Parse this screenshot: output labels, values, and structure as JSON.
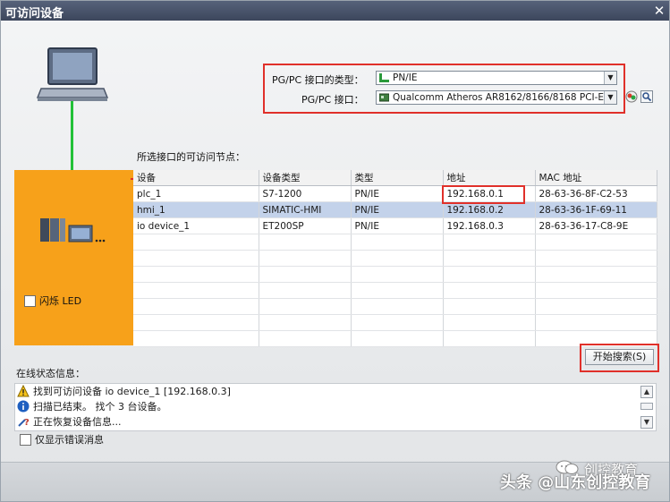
{
  "window": {
    "title": "可访问设备",
    "close_glyph": "✕"
  },
  "interface_form": {
    "type_label": "PG/PC 接口的类型：",
    "type_value": "PN/IE",
    "interface_label": "PG/PC 接口：",
    "interface_value": "Qualcomm Atheros AR8162/8166/8168 PCI-E..."
  },
  "nodes_label": "所选接口的可访问节点：",
  "table": {
    "columns": [
      "设备",
      "设备类型",
      "类型",
      "地址",
      "MAC 地址"
    ],
    "rows": [
      {
        "device": "plc_1",
        "device_type": "S7-1200",
        "type": "PN/IE",
        "address": "192.168.0.1",
        "mac": "28-63-36-8F-C2-53",
        "selected": false
      },
      {
        "device": "hmi_1",
        "device_type": "SIMATIC-HMI",
        "type": "PN/IE",
        "address": "192.168.0.2",
        "mac": "28-63-36-1F-69-11",
        "selected": true
      },
      {
        "device": "io device_1",
        "device_type": "ET200SP",
        "type": "PN/IE",
        "address": "192.168.0.3",
        "mac": "28-63-36-17-C8-9E",
        "selected": false
      }
    ]
  },
  "flash_led_label": "闪烁 LED",
  "search_button": "开始搜索(S)",
  "status": {
    "title": "在线状态信息：",
    "messages": [
      {
        "icon": "warning-icon",
        "text": "找到可访问设备 io device_1 [192.168.0.3]"
      },
      {
        "icon": "info-icon",
        "text": "扫描已结束。 找个 3 台设备。"
      },
      {
        "icon": "restore-icon",
        "text": "正在恢复设备信息..."
      }
    ],
    "only_errors_label": "仅显示错误消息"
  },
  "watermark": {
    "main": "头条 @山东创控教育",
    "secondary": "创控教育"
  },
  "colors": {
    "accent_orange": "#f7a11a",
    "link_green": "#22c138",
    "highlight_red": "#e0302a",
    "selection_blue": "#c3d2ea"
  }
}
